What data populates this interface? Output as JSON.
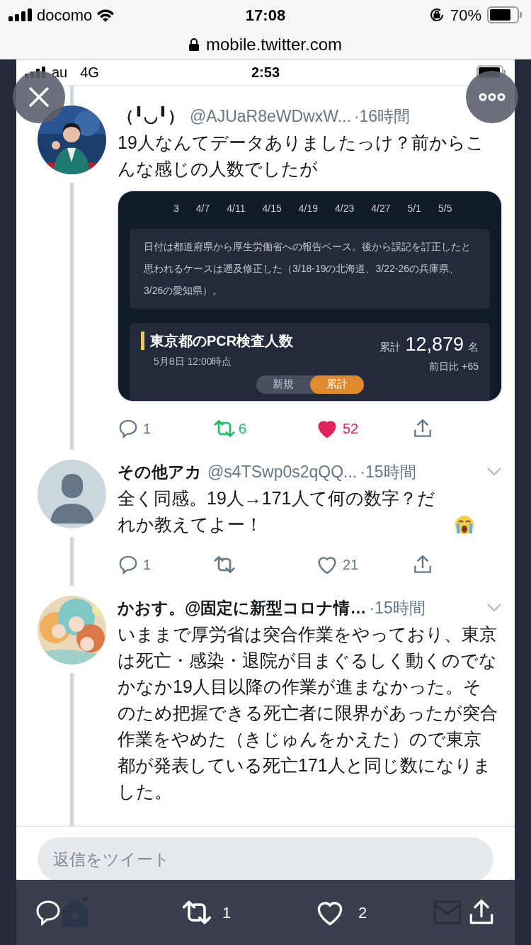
{
  "outer_status_bar": {
    "carrier": "docomo",
    "time": "17:08",
    "battery": "70%"
  },
  "address_bar": {
    "url": "mobile.twitter.com"
  },
  "inner_status_bar": {
    "carrier": "au",
    "network": "4G",
    "time": "2:53"
  },
  "tweets": [
    {
      "name": "（╹◡╹）",
      "handle": "@AJUaR8eWDwxW...",
      "time": "·16時間",
      "text": "19人なんてデータありましたっけ？前からこんな感じの人数でしたが",
      "embed": {
        "axis_labels": [
          "3",
          "4/7",
          "4/11",
          "4/15",
          "4/19",
          "4/23",
          "4/27",
          "5/1",
          "5/5"
        ],
        "note": "日付は都道府県から厚生労働省への報告ベース。後から誤記を訂正したと思われるケースは遡及修正した（3/18-19の北海道、3/22-26の兵庫県、3/26の愛知県）。",
        "stat_title": "東京都のPCR検査人数",
        "stat_time": "5月8日 12:00時点",
        "total_label": "累計",
        "total": "12,879",
        "unit": "名",
        "change": "前日比 +65",
        "toggle": [
          {
            "label": "新規",
            "selected": false
          },
          {
            "label": "累計",
            "selected": true
          }
        ]
      },
      "actions": {
        "replies": "1",
        "retweets": "6",
        "likes": "52",
        "retweeted": true,
        "liked": true
      }
    },
    {
      "avatar": {
        "kind": "default"
      },
      "name": "その他アカ",
      "handle": "@s4TSwp0s2qQQ...",
      "time": "·15時間",
      "text": "全く同感。19人→171人て何の数字？だれか教えてよー！",
      "emoji": {
        "kind": "crying"
      },
      "actions": {
        "replies": "1",
        "likes": "21",
        "retweeted": false,
        "liked": false
      }
    },
    {
      "avatar": {
        "kind": "illustration"
      },
      "name": "かおす。@固定に新型コロナ情…",
      "time": "·15時間",
      "text": "いままで厚労省は突合作業をやっており、東京は死亡・感染・退院が目まぐるしく動くのでなかなか19人目以降の作業が進まなかった。そのため把握できる死亡者に限界があったが突合作業をやめた（きじゅんをかえた）ので東京都が発表している死亡171人と同じ数になりました。"
    }
  ],
  "reply_field": {
    "placeholder": "返信をツイート"
  },
  "toolbar": {
    "retweets": "1",
    "likes": "2"
  }
}
